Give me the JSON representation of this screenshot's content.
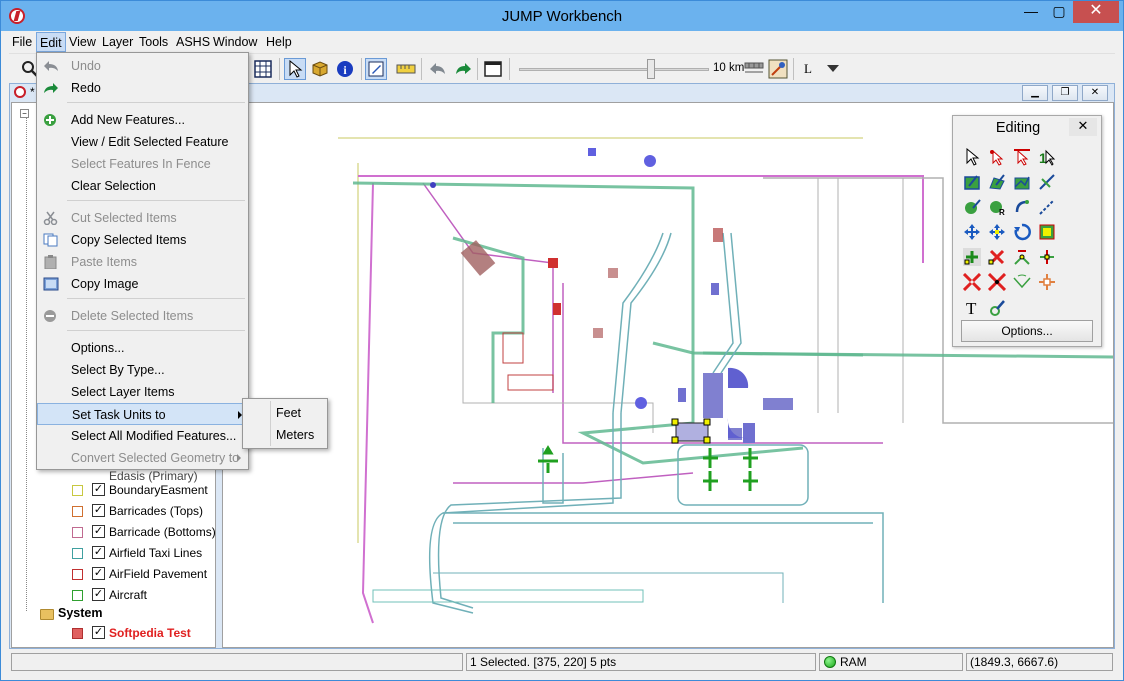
{
  "window": {
    "title": "JUMP Workbench",
    "min_glyph": "—",
    "max_glyph": "▢",
    "close_glyph": "✕"
  },
  "menubar": [
    "File",
    "Edit",
    "View",
    "Layer",
    "Tools",
    "ASHS",
    "Window",
    "Help"
  ],
  "toolbar": {
    "scale_label": "10 km",
    "mode_letter": "L"
  },
  "inner_frame": {
    "title": "*"
  },
  "edit_menu": {
    "items": [
      {
        "label": "Undo",
        "disabled": true,
        "icon": "undo-icon"
      },
      {
        "label": "Redo",
        "disabled": false,
        "icon": "redo-icon"
      },
      {
        "label": "Add New Features...",
        "disabled": false,
        "icon": "add-icon"
      },
      {
        "label": "View / Edit Selected Feature",
        "disabled": false
      },
      {
        "label": "Select Features In Fence",
        "disabled": true
      },
      {
        "label": "Clear Selection",
        "disabled": false
      },
      {
        "label": "Cut Selected Items",
        "disabled": true,
        "icon": "cut-icon"
      },
      {
        "label": "Copy Selected Items",
        "disabled": false,
        "icon": "copy-icon"
      },
      {
        "label": "Paste Items",
        "disabled": true,
        "icon": "paste-icon"
      },
      {
        "label": "Copy Image",
        "disabled": false,
        "icon": "image-icon"
      },
      {
        "label": "Delete Selected Items",
        "disabled": true,
        "icon": "delete-icon"
      },
      {
        "label": "Options...",
        "disabled": false
      },
      {
        "label": "Select By Type...",
        "disabled": false
      },
      {
        "label": "Select Layer Items",
        "disabled": false
      },
      {
        "label": "Set Task Units to",
        "disabled": false,
        "submenu": true,
        "highlight": true
      },
      {
        "label": "Select All Modified Features...",
        "disabled": false
      },
      {
        "label": "Convert Selected Geometry to",
        "disabled": true,
        "submenu": true
      }
    ]
  },
  "units_submenu": [
    "Feet",
    "Meters"
  ],
  "layers": {
    "partial_label": "Edasis (Primary)",
    "items": [
      {
        "label": "BoundaryEasment",
        "checked": true,
        "color": "#c8c840"
      },
      {
        "label": "Barricades (Tops)",
        "checked": true,
        "color": "#d07030"
      },
      {
        "label": "Barricade (Bottoms)",
        "checked": true,
        "color": "#c06a90"
      },
      {
        "label": "Airfield Taxi Lines",
        "checked": true,
        "color": "#40a0a0"
      },
      {
        "label": "AirField Pavement",
        "checked": true,
        "color": "#c03030"
      },
      {
        "label": "Aircraft",
        "checked": true,
        "color": "#30a030"
      }
    ],
    "system_group": "System",
    "system_item": {
      "label": "Softpedia Test",
      "checked": true,
      "color": "#e04040"
    }
  },
  "editing_palette": {
    "title": "Editing",
    "close_glyph": "✕",
    "options_label": "Options..."
  },
  "statusbar": {
    "message": "",
    "selection": "1 Selected. [375, 220] 5 pts",
    "ram": "RAM",
    "coords": "(1849.3, 6667.6)"
  },
  "colors": {
    "title_bar": "#6bb2ee",
    "selection_highlight": "#d3e4f7",
    "disabled_text": "#8d8d8d"
  }
}
